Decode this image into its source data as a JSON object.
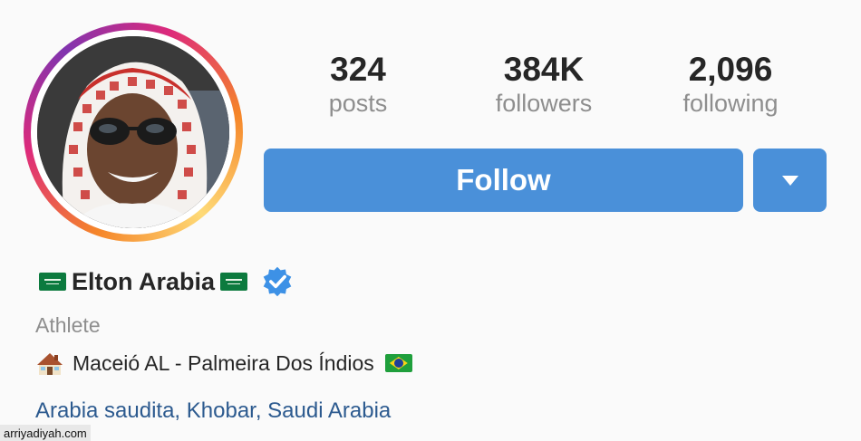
{
  "profile": {
    "display_name": "Elton Arabia",
    "category": "Athlete",
    "bio_line": "Maceió AL - Palmeira Dos Índios",
    "location": "Arabia saudita, Khobar, Saudi Arabia",
    "verified": true
  },
  "stats": {
    "posts": {
      "value": "324",
      "label": "posts"
    },
    "followers": {
      "value": "384K",
      "label": "followers"
    },
    "following": {
      "value": "2,096",
      "label": "following"
    }
  },
  "actions": {
    "follow_label": "Follow"
  },
  "watermark": "arriyadiyah.com",
  "icons": {
    "flag_left": "saudi-flag-icon",
    "flag_right": "saudi-flag-icon",
    "verified": "verified-badge-icon",
    "house": "house-icon",
    "bio_flag": "brazil-flag-icon",
    "dropdown": "chevron-down-icon"
  },
  "colors": {
    "accent": "#4a90d9",
    "link": "#2c5a8f",
    "muted": "#8e8e8e",
    "text": "#262626"
  }
}
